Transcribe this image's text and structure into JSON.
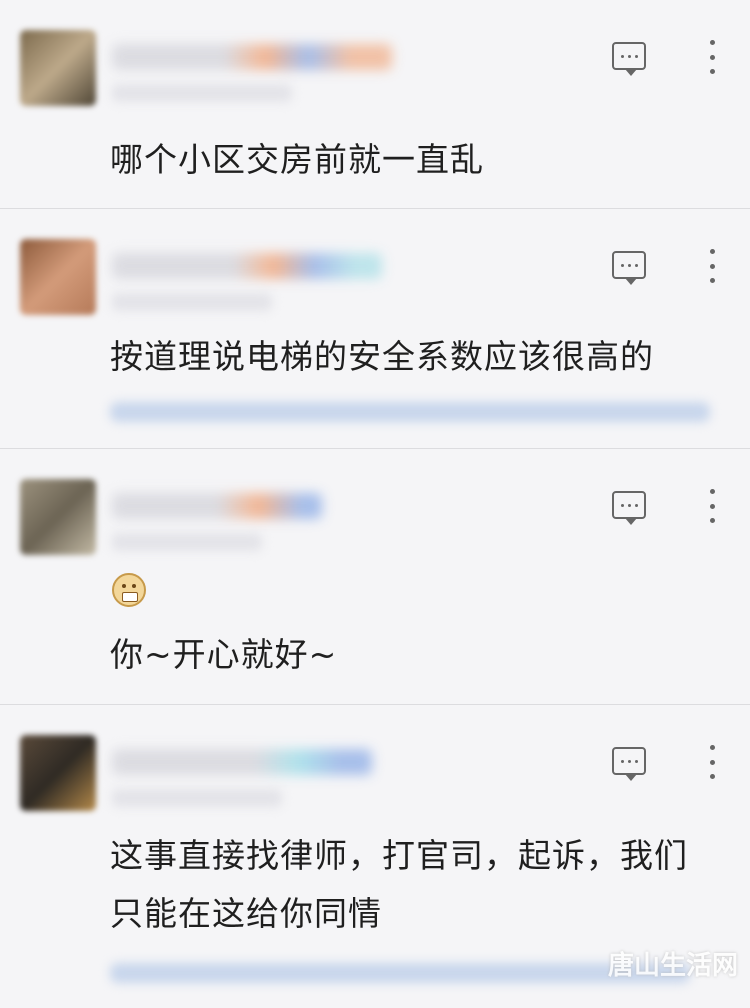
{
  "comments": [
    {
      "text": "哪个小区交房前就一直乱"
    },
    {
      "text": "按道理说电梯的安全系数应该很高的"
    },
    {
      "text": "你~开心就好~",
      "emoji": "grimace-emoji"
    },
    {
      "text": "这事直接找律师，打官司，起诉，我们只能在这给你同情"
    }
  ],
  "icons": {
    "reply": "comment-reply-icon",
    "more": "more-vertical-icon"
  },
  "watermark": "唐山生活网"
}
